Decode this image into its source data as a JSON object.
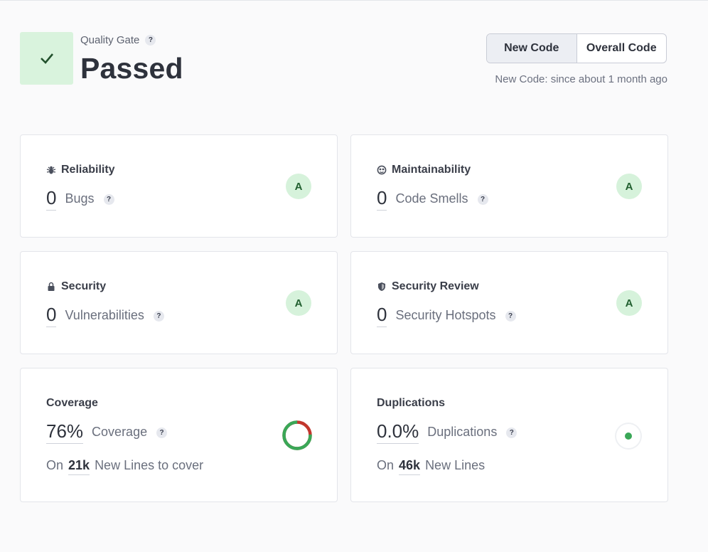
{
  "quality_gate": {
    "label": "Quality Gate",
    "help": "?",
    "status": "Passed",
    "status_icon": "check-icon"
  },
  "view_toggle": {
    "new_code": "New Code",
    "overall_code": "Overall Code",
    "active": "new_code"
  },
  "new_code_since": "New Code: since about 1 month ago",
  "cards": {
    "reliability": {
      "title": "Reliability",
      "icon": "bug-icon",
      "value": "0",
      "label": "Bugs",
      "help": "?",
      "rating": "A"
    },
    "maintainability": {
      "title": "Maintainability",
      "icon": "maintainability-icon",
      "value": "0",
      "label": "Code Smells",
      "help": "?",
      "rating": "A"
    },
    "security": {
      "title": "Security",
      "icon": "lock-icon",
      "value": "0",
      "label": "Vulnerabilities",
      "help": "?",
      "rating": "A"
    },
    "security_review": {
      "title": "Security Review",
      "icon": "shield-icon",
      "value": "0",
      "label": "Security Hotspots",
      "help": "?",
      "rating": "A"
    },
    "coverage": {
      "title": "Coverage",
      "value": "76%",
      "label": "Coverage",
      "help": "?",
      "sub_prefix": "On",
      "sub_number": "21k",
      "sub_suffix": "New Lines to cover",
      "percent": 76
    },
    "duplications": {
      "title": "Duplications",
      "value": "0.0%",
      "label": "Duplications",
      "help": "?",
      "sub_prefix": "On",
      "sub_number": "46k",
      "sub_suffix": "New Lines"
    }
  },
  "colors": {
    "pass_bg": "#d9f3dd",
    "rating_a": "#d6f2db",
    "coverage_ok": "#3aa757",
    "coverage_missing": "#c2372d"
  }
}
